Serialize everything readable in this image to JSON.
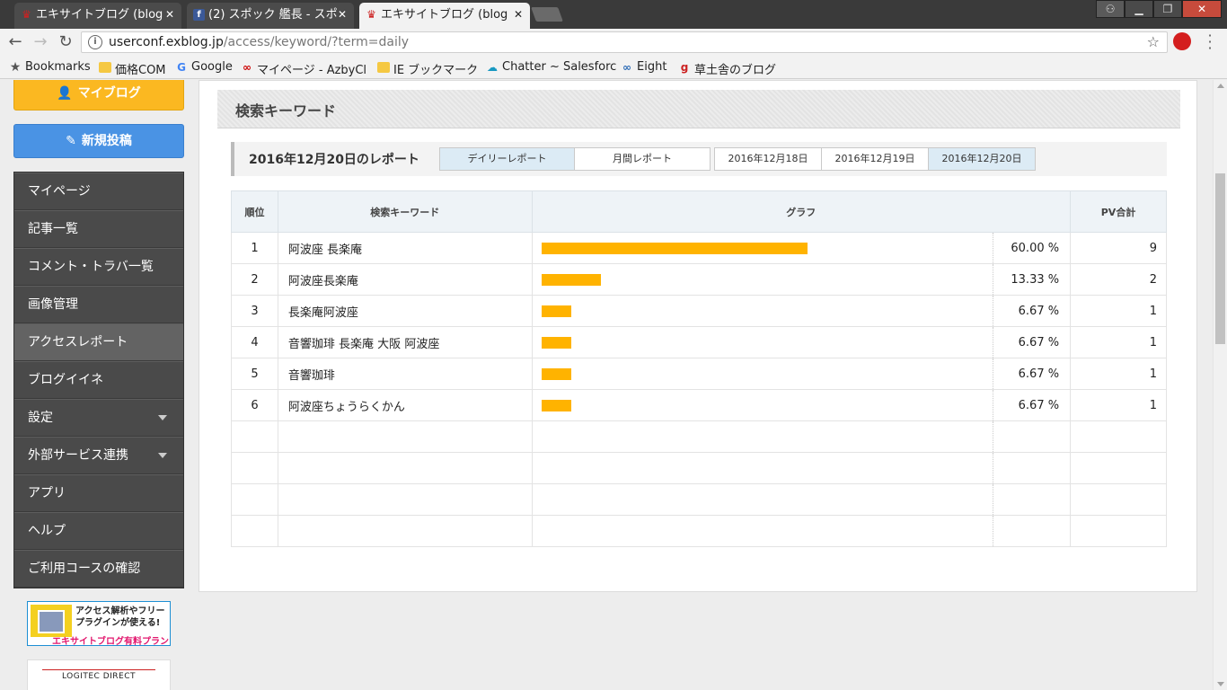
{
  "browser": {
    "tabs": [
      {
        "title": "エキサイトブログ (blog",
        "close": "✕"
      },
      {
        "title": "(2) スポック 艦長 - スポ",
        "close": "✕"
      },
      {
        "title": "エキサイトブログ (blog",
        "close": "✕"
      }
    ],
    "url_host": "userconf.exblog.jp",
    "url_path": "/access/keyword/?term=daily",
    "bookmarks": [
      {
        "label": "Bookmarks",
        "icon": "star-icon"
      },
      {
        "label": "価格COM",
        "icon": "folder-icon"
      },
      {
        "label": "Google",
        "icon": "google-icon"
      },
      {
        "label": "マイページ - AzbyCl",
        "icon": "azby-icon"
      },
      {
        "label": "IE ブックマーク",
        "icon": "folder-icon"
      },
      {
        "label": "Chatter ~ Salesforc",
        "icon": "salesforce-icon"
      },
      {
        "label": "Eight",
        "icon": "eight-icon"
      },
      {
        "label": "草土舎のブログ",
        "icon": "blog-icon"
      }
    ]
  },
  "sidebar": {
    "myblog_label": "マイブログ",
    "newpost_label": "新規投稿",
    "items": [
      {
        "label": "マイページ"
      },
      {
        "label": "記事一覧"
      },
      {
        "label": "コメント・トラバ一覧"
      },
      {
        "label": "画像管理"
      },
      {
        "label": "アクセスレポート"
      },
      {
        "label": "ブログイイネ"
      },
      {
        "label": "設定"
      },
      {
        "label": "外部サービス連携"
      },
      {
        "label": "アプリ"
      },
      {
        "label": "ヘルプ"
      },
      {
        "label": "ご利用コースの確認"
      }
    ],
    "active_index": 4,
    "promo": {
      "line1": "アクセス解析やフリー",
      "line2": "プラグインが使える!",
      "line3": "エキサイトブログ有料プラン"
    },
    "logitec_label": "LOGITEC DIRECT"
  },
  "main": {
    "section_title": "検索キーワード",
    "report_title": "2016年12月20日のレポート",
    "report_tabs": [
      {
        "label": "デイリーレポート",
        "selected": true
      },
      {
        "label": "月間レポート",
        "selected": false
      }
    ],
    "date_tabs": [
      {
        "label": "2016年12月18日",
        "selected": false
      },
      {
        "label": "2016年12月19日",
        "selected": false
      },
      {
        "label": "2016年12月20日",
        "selected": true
      }
    ],
    "table": {
      "headers": {
        "rank": "順位",
        "keyword": "検索キーワード",
        "graph": "グラフ",
        "pv": "PV合計"
      },
      "rows": [
        {
          "rank": "1",
          "keyword": "阿波座 長楽庵",
          "share": 60.0,
          "percent": "60.00 %",
          "pv": "9"
        },
        {
          "rank": "2",
          "keyword": "阿波座長楽庵",
          "share": 13.33,
          "percent": "13.33 %",
          "pv": "2"
        },
        {
          "rank": "3",
          "keyword": "長楽庵阿波座",
          "share": 6.67,
          "percent": "6.67 %",
          "pv": "1"
        },
        {
          "rank": "4",
          "keyword": "音響珈琲 長楽庵 大阪 阿波座",
          "share": 6.67,
          "percent": "6.67 %",
          "pv": "1"
        },
        {
          "rank": "5",
          "keyword": "音響珈琲",
          "share": 6.67,
          "percent": "6.67 %",
          "pv": "1"
        },
        {
          "rank": "6",
          "keyword": "阿波座ちょうらくかん",
          "share": 6.67,
          "percent": "6.67 %",
          "pv": "1"
        }
      ],
      "empty_rows": 4
    },
    "bar_color": "#ffb300"
  }
}
